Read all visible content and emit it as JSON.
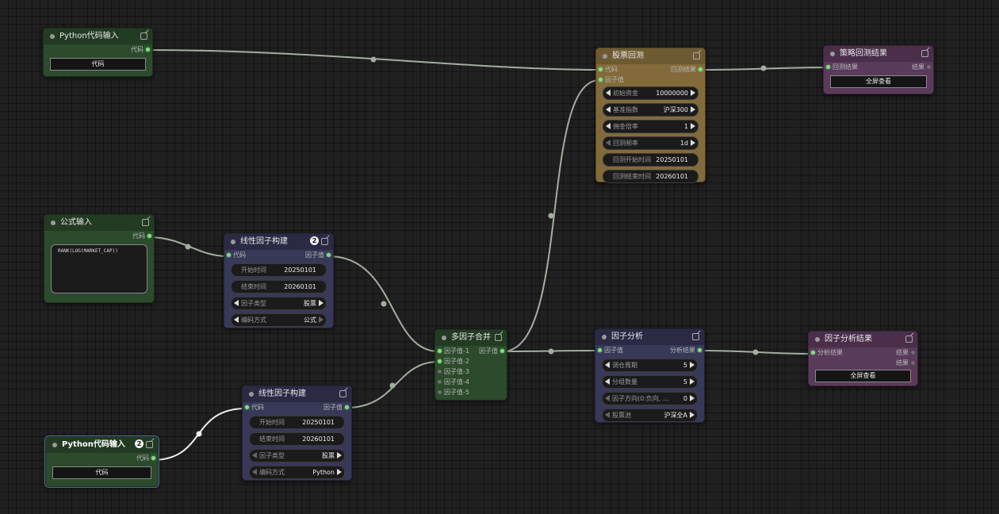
{
  "nodes": {
    "python_input_1": {
      "title": "Python代码输入",
      "output": "代码",
      "button": "代码"
    },
    "formula_input": {
      "title": "公式输入",
      "output": "代码",
      "formula": "RANK(LOG(MARKET_CAP))"
    },
    "linear_factor_1": {
      "title": "线性因子构建",
      "badge": "2",
      "input": "代码",
      "output": "因子值",
      "start_label": "开始时间",
      "start_value": "20250101",
      "end_label": "结束时间",
      "end_value": "20260101",
      "type_label": "因子类型",
      "type_value": "股票",
      "encode_label": "编码方式",
      "encode_value": "公式"
    },
    "linear_factor_2": {
      "title": "线性因子构建",
      "input": "代码",
      "output": "因子值",
      "start_label": "开始时间",
      "start_value": "20250101",
      "end_label": "结束时间",
      "end_value": "20260101",
      "type_label": "因子类型",
      "type_value": "股票",
      "encode_label": "编码方式",
      "encode_value": "Python"
    },
    "python_input_2": {
      "title": "Python代码输入",
      "badge": "2",
      "output": "代码",
      "button": "代码"
    },
    "multi_merge": {
      "title": "多因子合并",
      "output": "因子值",
      "inputs": [
        "因子值-1",
        "因子值-2",
        "因子值-3",
        "因子值-4",
        "因子值-5"
      ]
    },
    "backtest": {
      "title": "股票回测",
      "input1": "代码",
      "input2": "因子值",
      "output": "回测结果",
      "capital_label": "初始资金",
      "capital_value": "10000000",
      "bench_label": "基准指数",
      "bench_value": "沪深300",
      "fee_label": "佣金倍率",
      "fee_value": "1",
      "freq_label": "回测频率",
      "freq_value": "1d",
      "bt_start_label": "回测开始时间",
      "bt_start_value": "20250101",
      "bt_end_label": "回测结束时间",
      "bt_end_value": "20260101"
    },
    "strategy_result": {
      "title": "策略回测结果",
      "input": "回测结果",
      "output": "结果",
      "button": "全屏查看"
    },
    "factor_analysis": {
      "title": "因子分析",
      "input": "因子值",
      "output": "分析结果",
      "period_label": "调仓周期",
      "period_value": "5",
      "groups_label": "分组数量",
      "groups_value": "5",
      "dir_label": "因子方向(0:负向, …",
      "dir_value": "0",
      "pool_label": "股票池",
      "pool_value": "沪深全A"
    },
    "factor_result": {
      "title": "因子分析结果",
      "input": "分析结果",
      "output1": "结果",
      "output2": "结果",
      "button": "全屏查看"
    }
  },
  "colors": {
    "link": "#a3ae9f",
    "link_selected": "#f0f0f0",
    "slot_active": "#7fe07f"
  }
}
